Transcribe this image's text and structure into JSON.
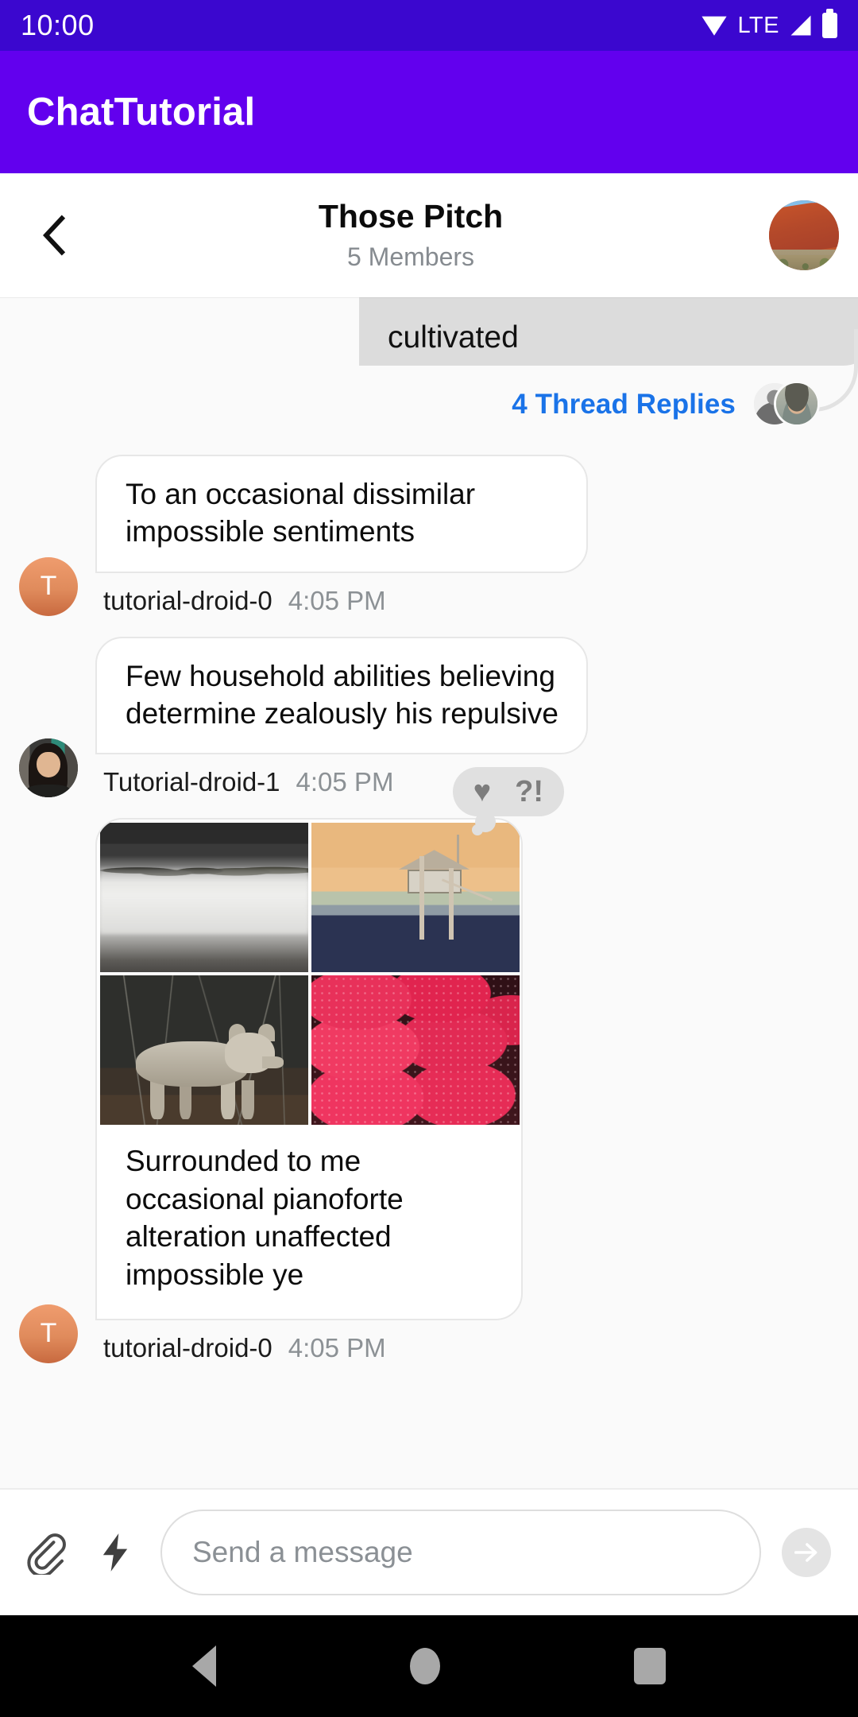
{
  "status_bar": {
    "clock": "10:00",
    "network_label": "LTE",
    "icons": [
      "wifi-icon",
      "signal-icon",
      "battery-icon"
    ]
  },
  "app_bar": {
    "title": "ChatTutorial"
  },
  "channel_header": {
    "back_icon": "chevron-left-icon",
    "title": "Those Pitch",
    "subtitle": "5 Members",
    "avatar_alt": "desert-rock-landscape"
  },
  "messages": {
    "truncated_top": {
      "text": "cultivated"
    },
    "thread": {
      "link_label": "4 Thread Replies",
      "participant_count": 2
    },
    "items": [
      {
        "avatar_type": "initial",
        "avatar_initial": "T",
        "text": "To an occasional dissimilar impossible sentiments",
        "sender": "tutorial-droid-0",
        "time": "4:05 PM"
      },
      {
        "avatar_type": "photo",
        "avatar_initial": "",
        "text": "Few household abilities believing determine zealously his repulsive",
        "sender": "Tutorial-droid-1",
        "time": "4:05 PM"
      }
    ],
    "attachment_message": {
      "avatar_type": "initial",
      "avatar_initial": "T",
      "caption": "Surrounded to me occasional pianoforte alteration unaffected impossible ye",
      "sender": "tutorial-droid-0",
      "time": "4:05 PM",
      "images": [
        {
          "alt": "foggy-forest-photo"
        },
        {
          "alt": "lifeguard-tower-dusk-photo"
        },
        {
          "alt": "coyote-in-woods-photo"
        },
        {
          "alt": "strawberries-photo"
        }
      ],
      "reactions": [
        {
          "icon": "heart-icon",
          "glyph": "♥"
        },
        {
          "icon": "interrobang-icon",
          "glyph": "?!"
        }
      ]
    }
  },
  "composer": {
    "attach_icon": "paperclip-icon",
    "command_icon": "lightning-bolt-icon",
    "placeholder": "Send a message",
    "value": "",
    "send_icon": "arrow-right-icon"
  },
  "nav_bar": {
    "back": "nav-back-icon",
    "home": "nav-home-icon",
    "recents": "nav-recents-icon"
  },
  "colors": {
    "status_bar": "#3b07cf",
    "app_bar": "#6200ee",
    "thread_link": "#1a73e8",
    "avatar_orange": "#e08b5c",
    "bubble_gray": "#dcdcdc"
  }
}
